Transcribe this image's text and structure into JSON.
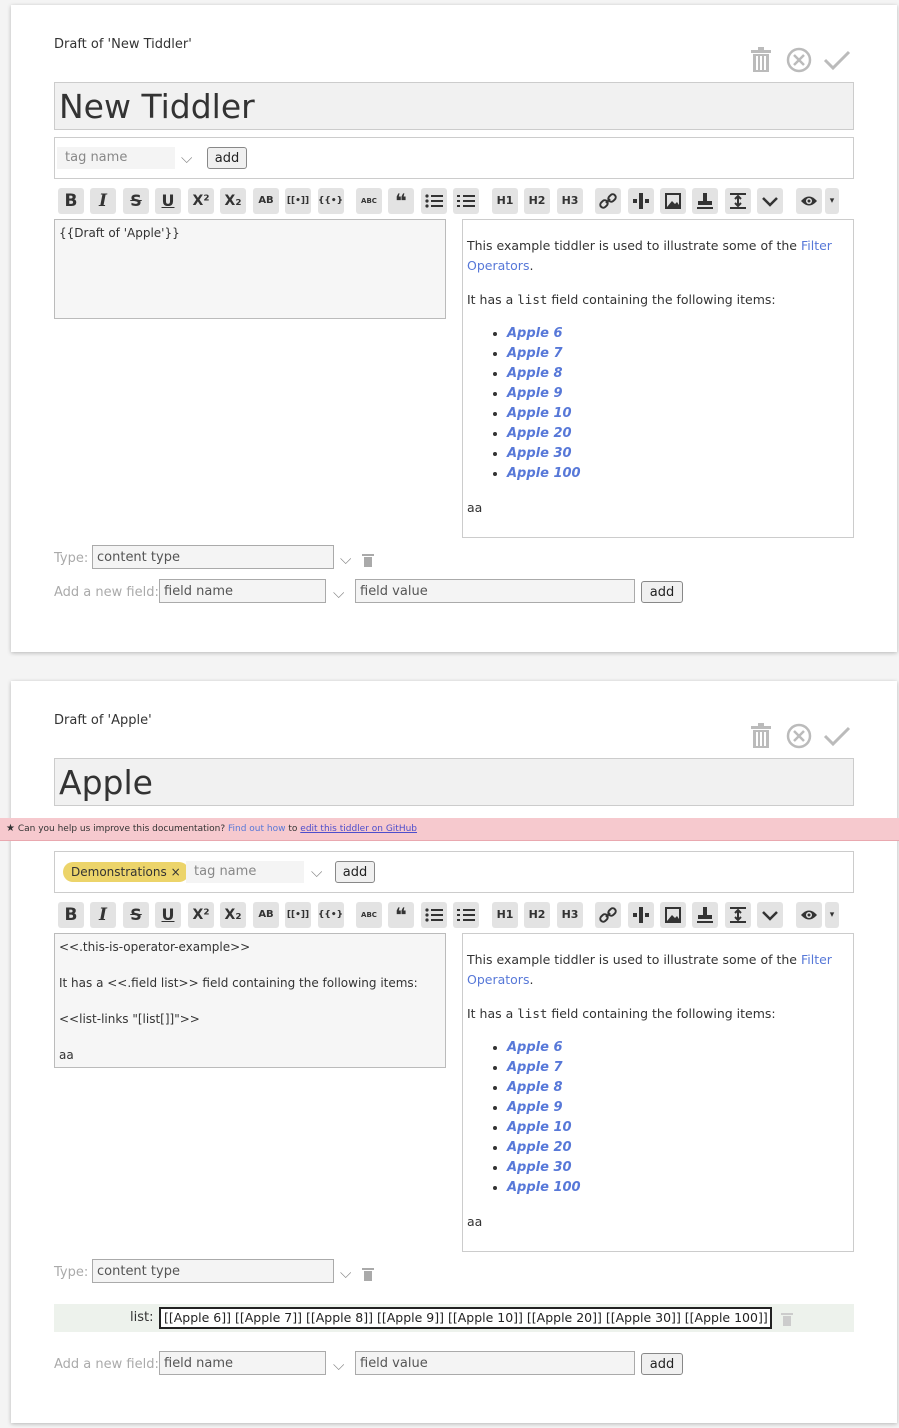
{
  "tiddler1": {
    "draft_label": "Draft of 'New Tiddler'",
    "title": "New Tiddler",
    "tag_placeholder": "tag name",
    "tag_add": "add",
    "editor_lines": [
      "{{Draft of 'Apple'}}"
    ],
    "type_label": "Type:",
    "type_placeholder": "content type",
    "newfield_label": "Add a new field:",
    "field_name_placeholder": "field name",
    "field_value_placeholder": "field value",
    "field_add": "add"
  },
  "tiddler2": {
    "draft_label": "Draft of 'Apple'",
    "title": "Apple",
    "tag": "Demonstrations",
    "tag_placeholder": "tag name",
    "tag_add": "add",
    "editor_lines": [
      "<<.this-is-operator-example>>",
      "",
      "It has a <<.field list>> field containing the following items:",
      "",
      "<<list-links \"[list[]]\">>",
      "",
      "aa"
    ],
    "type_label": "Type:",
    "type_placeholder": "content type",
    "list_label": "list:",
    "list_value": "[[Apple 6]] [[Apple 7]] [[Apple 8]] [[Apple 9]] [[Apple 10]] [[Apple 20]] [[Apple 30]] [[Apple 100]]",
    "newfield_label": "Add a new field:",
    "field_name_placeholder": "field name",
    "field_value_placeholder": "field value",
    "field_add": "add"
  },
  "preview": {
    "intro_before": "This example tiddler is used to illustrate some of the ",
    "intro_link": "Filter Operators",
    "intro_after": ".",
    "list_before": "It has a ",
    "list_code": "list",
    "list_after": " field containing the following items:",
    "items": [
      "Apple 6",
      "Apple 7",
      "Apple 8",
      "Apple 9",
      "Apple 10",
      "Apple 20",
      "Apple 30",
      "Apple 100"
    ],
    "footer": "aa"
  },
  "toolbar": {
    "bold": "B",
    "italic": "I",
    "strike": "S",
    "underline": "U",
    "superscript": "X²",
    "subscript": "X₂",
    "smallcaps": "AB",
    "link": "[[•]]",
    "transclude": "{{•}}",
    "mono": "ABC",
    "quote": "❝",
    "h1": "H1",
    "h2": "H2",
    "h3": "H3"
  },
  "banner": {
    "star": "★",
    "text": "Can you help us improve this documentation?",
    "find_out": "Find out how",
    "to": "to",
    "edit_link": "edit this tiddler on GitHub"
  },
  "colors": {
    "accent": "#5778d8",
    "tag": "#ecd46a",
    "banner": "#f6c9ce"
  },
  "icons": [
    "trash-icon",
    "cancel-icon",
    "check-icon",
    "chevron-down-icon",
    "eye-icon"
  ]
}
